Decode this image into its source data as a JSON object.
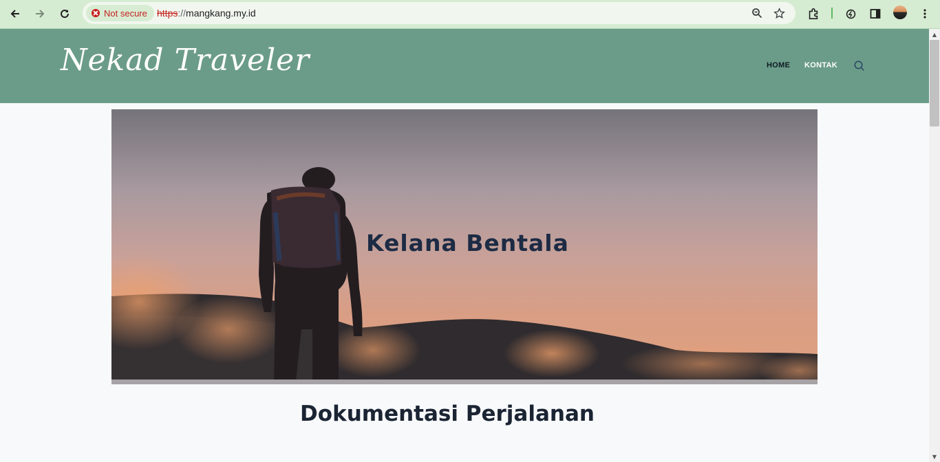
{
  "browser": {
    "back_icon": "arrow-left-icon",
    "forward_icon": "arrow-right-icon",
    "reload_icon": "reload-icon",
    "security_label": "Not secure",
    "url_scheme": "https",
    "url_separator": "://",
    "url_host": "mangkang.my.id",
    "zoom_icon": "zoom-icon",
    "bookmark_icon": "star-icon",
    "extensions_icon": "puzzle-icon",
    "performance_icon": "leaf-icon",
    "side_panel_icon": "side-panel-icon",
    "menu_icon": "kebab-menu-icon",
    "colors": {
      "chrome_bg": "#d6ecd2",
      "insecure": "#c5221f"
    }
  },
  "site": {
    "logo": "Nekad Traveler",
    "nav": {
      "home": "HOME",
      "kontak": "KONTAK"
    },
    "search_icon": "search-icon",
    "colors": {
      "header_bg": "#6b9c89",
      "title": "#1d2b44"
    }
  },
  "hero": {
    "title": "Kelana Bentala"
  },
  "main": {
    "section_title": "Dokumentasi Perjalanan"
  }
}
